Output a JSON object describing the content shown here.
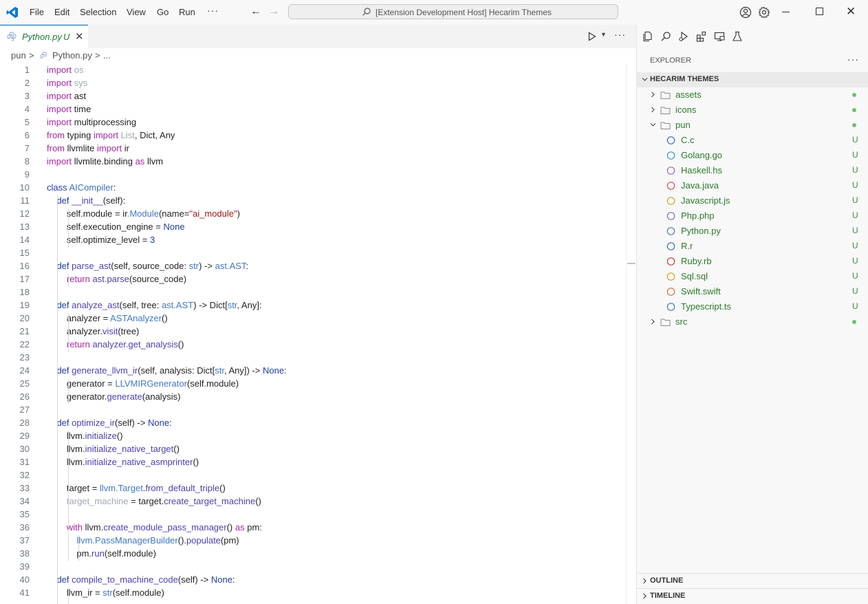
{
  "titlebar": {
    "menu": [
      "File",
      "Edit",
      "Selection",
      "View",
      "Go",
      "Run"
    ],
    "more": "···",
    "search_text": "[Extension Development Host] Hecarim Themes"
  },
  "tab": {
    "label": "Python.py",
    "modified": "U"
  },
  "breadcrumb": [
    "pun",
    ">",
    "Python.py",
    ">",
    "..."
  ],
  "editor": {
    "lines": [
      [
        [
          "import ",
          "kw"
        ],
        [
          "os",
          "dim"
        ]
      ],
      [
        [
          "import ",
          "kw"
        ],
        [
          "sys",
          "dim"
        ]
      ],
      [
        [
          "import ",
          "kw"
        ],
        [
          "ast",
          "nm"
        ]
      ],
      [
        [
          "import ",
          "kw"
        ],
        [
          "time",
          "nm"
        ]
      ],
      [
        [
          "import ",
          "kw"
        ],
        [
          "multiprocessing",
          "nm"
        ]
      ],
      [
        [
          "from ",
          "kw"
        ],
        [
          "typing ",
          "nm"
        ],
        [
          "import ",
          "kw"
        ],
        [
          "List",
          "dim"
        ],
        [
          ", Dict, Any",
          "nm"
        ]
      ],
      [
        [
          "from ",
          "kw"
        ],
        [
          "llvmlite ",
          "nm"
        ],
        [
          "import ",
          "kw"
        ],
        [
          "ir",
          "nm"
        ]
      ],
      [
        [
          "import ",
          "kw"
        ],
        [
          "llvmlite.binding ",
          "nm"
        ],
        [
          "as ",
          "kw"
        ],
        [
          "llvm",
          "nm"
        ]
      ],
      [],
      [
        [
          "class ",
          "kw2"
        ],
        [
          "AICompiler",
          "cl"
        ],
        [
          ":",
          "nm"
        ]
      ],
      [
        [
          "    ",
          "nm"
        ],
        [
          "def ",
          "kw2"
        ],
        [
          "__init__",
          "fn"
        ],
        [
          "(self):",
          "nm"
        ]
      ],
      [
        [
          "        self.module = ",
          "nm"
        ],
        [
          "ir",
          "nm"
        ],
        [
          ".Module",
          "ty"
        ],
        [
          "(name=",
          "nm"
        ],
        [
          "\"ai_module\"",
          "str"
        ],
        [
          ")",
          "nm"
        ]
      ],
      [
        [
          "        self.execution_engine = ",
          "nm"
        ],
        [
          "None",
          "kw2"
        ]
      ],
      [
        [
          "        self.optimize_level = ",
          "nm"
        ],
        [
          "3",
          "kw2"
        ]
      ],
      [],
      [
        [
          "    ",
          "nm"
        ],
        [
          "def ",
          "kw2"
        ],
        [
          "parse_ast",
          "fn"
        ],
        [
          "(self, source_code: ",
          "nm"
        ],
        [
          "str",
          "ty"
        ],
        [
          ") -> ",
          "nm"
        ],
        [
          "ast.AST",
          "ty"
        ],
        [
          ":",
          "nm"
        ]
      ],
      [
        [
          "        ",
          "nm"
        ],
        [
          "return ",
          "kw"
        ],
        [
          "ast.parse",
          "fn"
        ],
        [
          "(source_code)",
          "nm"
        ]
      ],
      [],
      [
        [
          "    ",
          "nm"
        ],
        [
          "def ",
          "kw2"
        ],
        [
          "analyze_ast",
          "fn"
        ],
        [
          "(self, tree: ",
          "nm"
        ],
        [
          "ast.AST",
          "ty"
        ],
        [
          ") -> Dict[",
          "nm"
        ],
        [
          "str",
          "ty"
        ],
        [
          ", Any]:",
          "nm"
        ]
      ],
      [
        [
          "        analyzer = ",
          "nm"
        ],
        [
          "ASTAnalyzer",
          "ty"
        ],
        [
          "()",
          "nm"
        ]
      ],
      [
        [
          "        analyzer.",
          "nm"
        ],
        [
          "visit",
          "fn"
        ],
        [
          "(tree)",
          "nm"
        ]
      ],
      [
        [
          "        ",
          "nm"
        ],
        [
          "return ",
          "kw"
        ],
        [
          "analyzer.get_analysis",
          "fn"
        ],
        [
          "()",
          "nm"
        ]
      ],
      [],
      [
        [
          "    ",
          "nm"
        ],
        [
          "def ",
          "kw2"
        ],
        [
          "generate_llvm_ir",
          "fn"
        ],
        [
          "(self, analysis: Dict[",
          "nm"
        ],
        [
          "str",
          "ty"
        ],
        [
          ", Any]) -> ",
          "nm"
        ],
        [
          "None",
          "kw2"
        ],
        [
          ":",
          "nm"
        ]
      ],
      [
        [
          "        generator = ",
          "nm"
        ],
        [
          "LLVMIRGenerator",
          "ty"
        ],
        [
          "(self.module)",
          "nm"
        ]
      ],
      [
        [
          "        generator.",
          "nm"
        ],
        [
          "generate",
          "fn"
        ],
        [
          "(analysis)",
          "nm"
        ]
      ],
      [],
      [
        [
          "    ",
          "nm"
        ],
        [
          "def ",
          "kw2"
        ],
        [
          "optimize_ir",
          "fn"
        ],
        [
          "(self) -> ",
          "nm"
        ],
        [
          "None",
          "kw2"
        ],
        [
          ":",
          "nm"
        ]
      ],
      [
        [
          "        llvm.",
          "nm"
        ],
        [
          "initialize",
          "fn"
        ],
        [
          "()",
          "nm"
        ]
      ],
      [
        [
          "        llvm.",
          "nm"
        ],
        [
          "initialize_native_target",
          "fn"
        ],
        [
          "()",
          "nm"
        ]
      ],
      [
        [
          "        llvm.",
          "nm"
        ],
        [
          "initialize_native_asmprinter",
          "fn"
        ],
        [
          "()",
          "nm"
        ]
      ],
      [],
      [
        [
          "        target = ",
          "nm"
        ],
        [
          "llvm.Target",
          "ty"
        ],
        [
          ".",
          "nm"
        ],
        [
          "from_default_triple",
          "fn"
        ],
        [
          "()",
          "nm"
        ]
      ],
      [
        [
          "        ",
          "nm"
        ],
        [
          "target_machine",
          "dim"
        ],
        [
          " = target.",
          "nm"
        ],
        [
          "create_target_machine",
          "fn"
        ],
        [
          "()",
          "nm"
        ]
      ],
      [],
      [
        [
          "        ",
          "nm"
        ],
        [
          "with ",
          "kw"
        ],
        [
          "llvm.",
          "nm"
        ],
        [
          "create_module_pass_manager",
          "fn"
        ],
        [
          "() ",
          "nm"
        ],
        [
          "as ",
          "kw"
        ],
        [
          "pm:",
          "nm"
        ]
      ],
      [
        [
          "            ",
          "nm"
        ],
        [
          "llvm.PassManagerBuilder",
          "ty"
        ],
        [
          "().",
          "nm"
        ],
        [
          "populate",
          "fn"
        ],
        [
          "(pm)",
          "nm"
        ]
      ],
      [
        [
          "            pm.",
          "nm"
        ],
        [
          "run",
          "fn"
        ],
        [
          "(self.module)",
          "nm"
        ]
      ],
      [],
      [
        [
          "    ",
          "nm"
        ],
        [
          "def ",
          "kw2"
        ],
        [
          "compile_to_machine_code",
          "fn"
        ],
        [
          "(self) -> ",
          "nm"
        ],
        [
          "None",
          "kw2"
        ],
        [
          ":",
          "nm"
        ]
      ],
      [
        [
          "        llvm_ir = ",
          "nm"
        ],
        [
          "str",
          "ty"
        ],
        [
          "(self.module)",
          "nm"
        ]
      ]
    ]
  },
  "explorer": {
    "title": "EXPLORER",
    "more": "···",
    "workspace": "HECARIM THEMES",
    "tree": [
      {
        "label": "assets",
        "type": "folder",
        "depth": 0,
        "open": false,
        "status": "dot"
      },
      {
        "label": "icons",
        "type": "folder",
        "depth": 0,
        "open": false,
        "status": "dot"
      },
      {
        "label": "pun",
        "type": "folder",
        "depth": 0,
        "open": true,
        "status": "dot"
      },
      {
        "label": "C.c",
        "type": "file",
        "depth": 1,
        "status": "U",
        "color": "#3b6fb6"
      },
      {
        "label": "Golang.go",
        "type": "file",
        "depth": 1,
        "status": "U",
        "color": "#28a0c8"
      },
      {
        "label": "Haskell.hs",
        "type": "file",
        "depth": 1,
        "status": "U",
        "color": "#9a6ad0"
      },
      {
        "label": "Java.java",
        "type": "file",
        "depth": 1,
        "status": "U",
        "color": "#d05050"
      },
      {
        "label": "Javascript.js",
        "type": "file",
        "depth": 1,
        "status": "U",
        "color": "#d4a020"
      },
      {
        "label": "Php.php",
        "type": "file",
        "depth": 1,
        "status": "U",
        "color": "#6a7ab8"
      },
      {
        "label": "Python.py",
        "type": "file",
        "depth": 1,
        "status": "U",
        "color": "#4a7ab0"
      },
      {
        "label": "R.r",
        "type": "file",
        "depth": 1,
        "status": "U",
        "color": "#3b6fb6"
      },
      {
        "label": "Ruby.rb",
        "type": "file",
        "depth": 1,
        "status": "U",
        "color": "#c83a3a"
      },
      {
        "label": "Sql.sql",
        "type": "file",
        "depth": 1,
        "status": "U",
        "color": "#d4a020"
      },
      {
        "label": "Swift.swift",
        "type": "file",
        "depth": 1,
        "status": "U",
        "color": "#e07030"
      },
      {
        "label": "Typescript.ts",
        "type": "file",
        "depth": 1,
        "status": "U",
        "color": "#3b7ac8"
      },
      {
        "label": "src",
        "type": "folder",
        "depth": 0,
        "open": false,
        "status": "dot"
      }
    ],
    "panels": [
      "OUTLINE",
      "TIMELINE"
    ]
  },
  "colors": {
    "accent": "#005fb8",
    "untracked": "#3a8f3a",
    "keyword": "#a626a4"
  }
}
